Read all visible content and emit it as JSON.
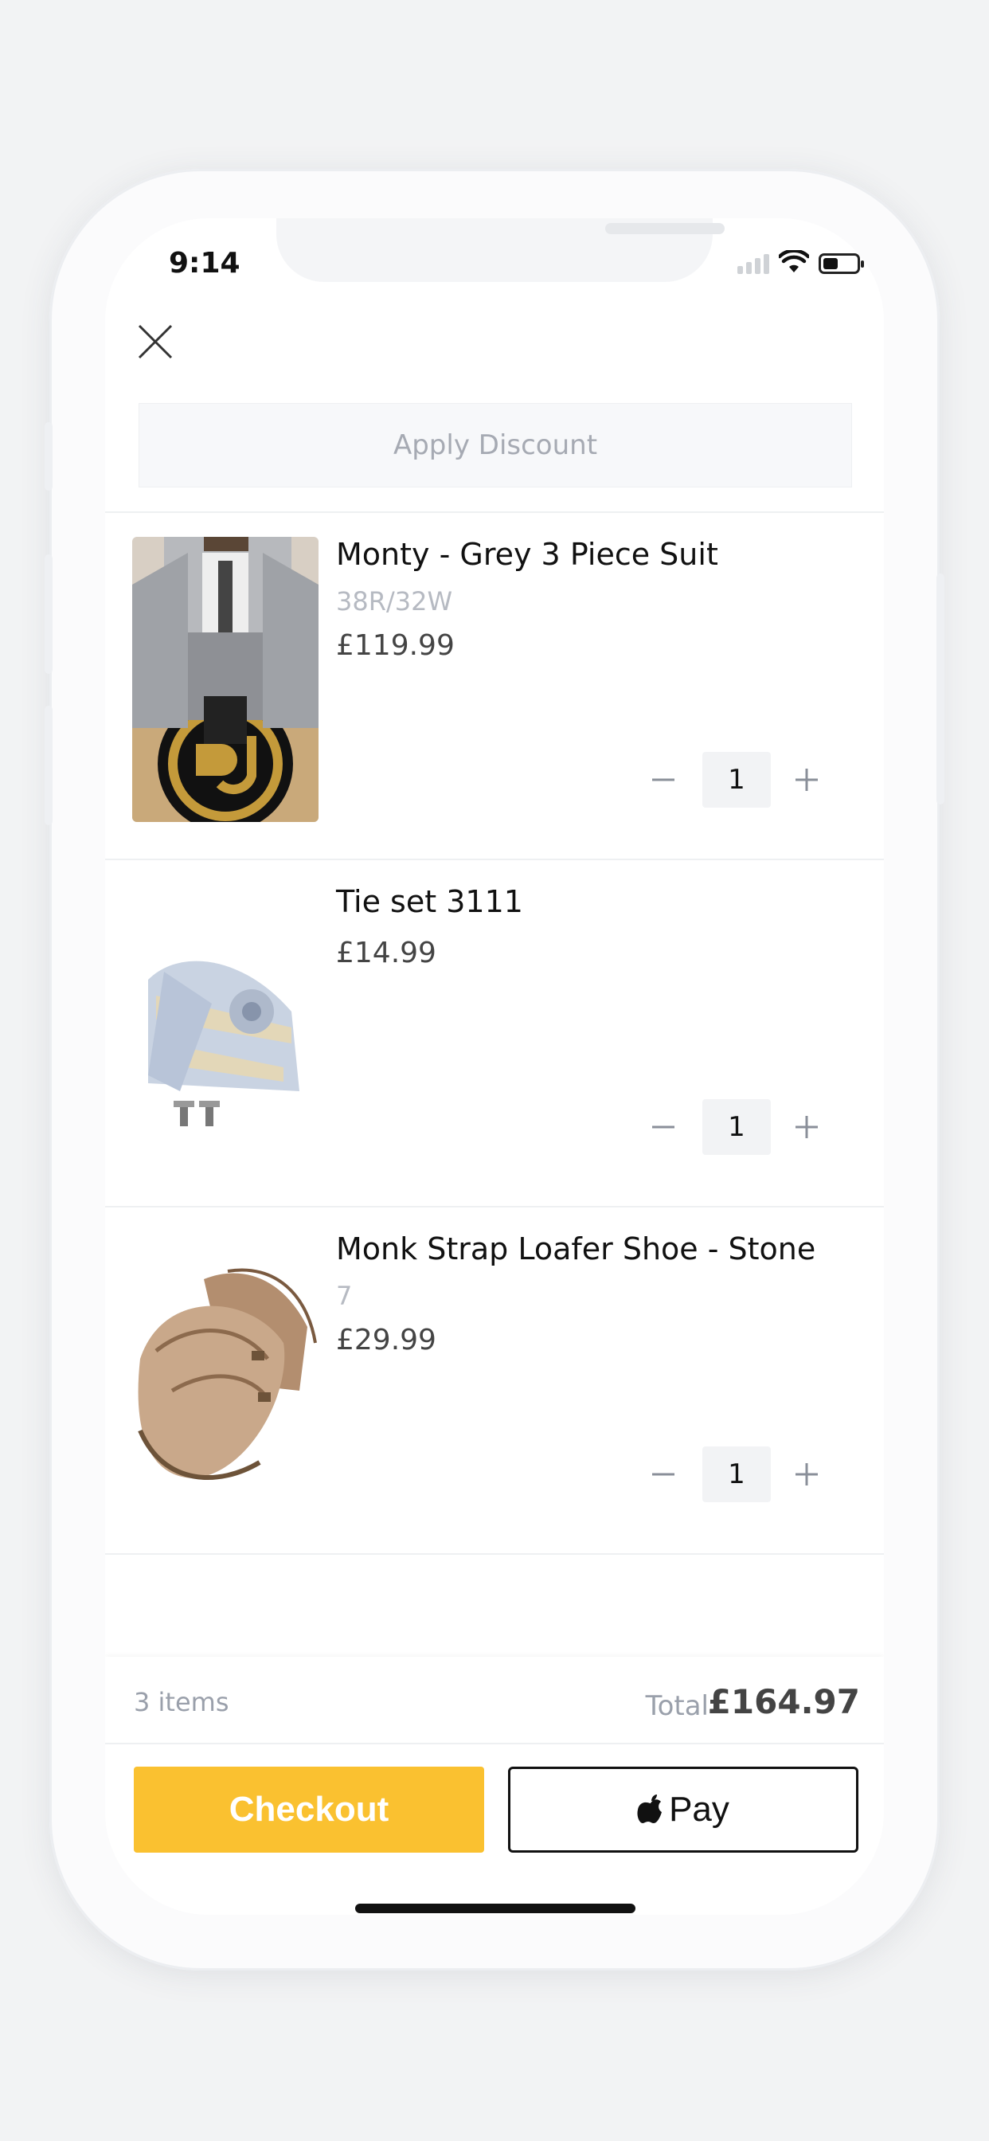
{
  "status_bar": {
    "time": "9:14"
  },
  "discount": {
    "label": "Apply Discount"
  },
  "cart_items": [
    {
      "title": "Monty - Grey 3 Piece Suit",
      "variant": "38R/32W",
      "price": "£119.99",
      "quantity": "1"
    },
    {
      "title": "Tie set 3111",
      "variant": "",
      "price": "£14.99",
      "quantity": "1"
    },
    {
      "title": "Monk Strap Loafer Shoe - Stone",
      "variant": "7",
      "price": "£29.99",
      "quantity": "1"
    }
  ],
  "summary": {
    "items_count": "3 items",
    "total_label": "Total",
    "total_value": "£164.97"
  },
  "actions": {
    "checkout_label": "Checkout",
    "applepay_label": "Pay"
  },
  "icons": {
    "close": "close-icon",
    "minus": "minus-icon",
    "plus": "plus-icon",
    "apple": "apple-logo-icon",
    "wifi": "wifi-icon",
    "battery": "battery-icon",
    "signal": "signal-icon"
  },
  "colors": {
    "accent": "#fac130",
    "muted_text": "#a6aab3",
    "text": "#111111"
  }
}
